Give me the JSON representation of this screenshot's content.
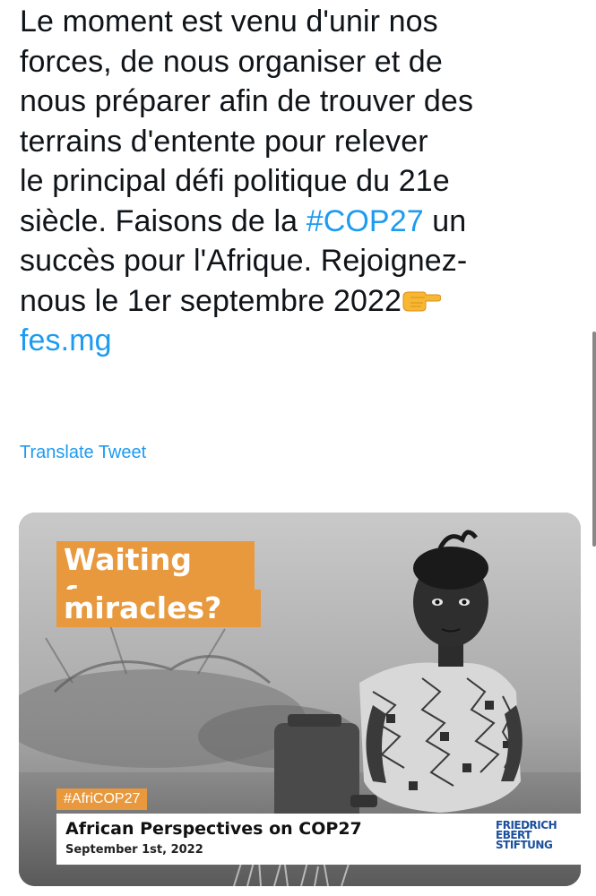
{
  "tweet": {
    "lines": [
      {
        "text": "Le moment est venu d'unir nos"
      },
      {
        "text": "forces, de nous organiser et de"
      },
      {
        "text": "nous préparer afin de trouver des"
      },
      {
        "text": "terrains d'entente pour relever"
      },
      {
        "text": "le principal défi politique du 21e"
      },
      {
        "pre": "siècle. Faisons de la ",
        "hashtag": "#COP27",
        "post": " un"
      },
      {
        "text": "succès pour l'Afrique. Rejoignez-"
      },
      {
        "text": "nous le 1er septembre 2022"
      },
      {
        "link": "fes.mg"
      }
    ],
    "emoji": "backhand-index-pointing-right",
    "translate_label": "Translate Tweet"
  },
  "media": {
    "headline_line1": "Waiting for",
    "headline_line2": "miracles?",
    "hashtag_badge": "#AfriCOP27",
    "caption_title": "African Perspectives on COP27",
    "caption_date": "September 1st, 2022",
    "logo_lines": [
      "FRIEDRICH",
      "EBERT",
      "STIFTUNG"
    ]
  },
  "colors": {
    "link": "#1d9bf0",
    "text": "#0f1419",
    "accent_orange": "#e8993e",
    "logo_blue": "#1b4f9c"
  }
}
